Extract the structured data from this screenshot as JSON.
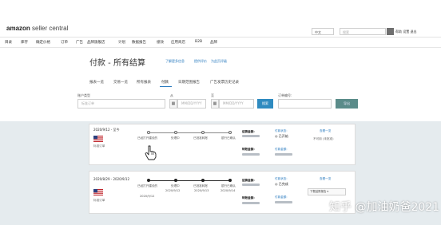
{
  "header": {
    "logo_main": "amazon",
    "logo_sub": " seller central",
    "lang": "中文",
    "search_placeholder": "搜索",
    "top_links": "帮助 设置 退出"
  },
  "nav": [
    "目录",
    "库存",
    "确定价格",
    "订单",
    "广告",
    "品牌旗舰店",
    "计划",
    "数据报告",
    "绩效",
    "应用商店",
    "B2B",
    "品牌"
  ],
  "page": {
    "title": "付款 - 所有结算",
    "title_links": [
      "了解更多信息",
      "提供评价",
      "为此页评级"
    ]
  },
  "tabs": [
    {
      "label": "报表一览",
      "active": false
    },
    {
      "label": "交易一览",
      "active": false
    },
    {
      "label": "所有报表",
      "active": false
    },
    {
      "label": "付款",
      "active": true
    },
    {
      "label": "日期范围报告",
      "active": false
    },
    {
      "label": "广告发票历史记录",
      "active": false
    }
  ],
  "filters": {
    "account_label": "账户类型",
    "account_value": "标准订单",
    "from_label": "从",
    "from_placeholder": "MM/DD/YYYY",
    "to_label": "至",
    "to_placeholder": "MM/DD/YYYY",
    "search_btn": "搜索",
    "order_label": "订单编号:",
    "export_btn": "导出"
  },
  "settlements": [
    {
      "date": "2020/9/12 - 至今",
      "type": "标准订单",
      "steps": [
        {
          "label": "已经打开建设的",
          "done": false
        },
        {
          "label": "处理中",
          "done": false
        },
        {
          "label": "已批准转账",
          "done": false
        },
        {
          "label": "银行已确认",
          "done": false
        }
      ],
      "info_labels": [
        "结算金额:",
        "转账金额:"
      ],
      "status_label": "付款状态:",
      "status_value": "已开始",
      "amount_label": "付款金额:",
      "action_link": "查看一览",
      "action_sub": "不可用 (未批准)"
    },
    {
      "date": "2020/8/29 - 2020/9/12",
      "type": "标准订单",
      "steps": [
        {
          "label": "已经打开建设的",
          "date": "2020/9/12",
          "done": true
        },
        {
          "label": "处理中",
          "date": "2020/9/12",
          "done": true
        },
        {
          "label": "已批准转账",
          "date": "2020/9/13",
          "done": true
        },
        {
          "label": "银行已确认",
          "date": "2020/9/14",
          "done": true
        }
      ],
      "info_labels": [
        "结算金额:",
        "转账金额:"
      ],
      "status_label": "付款状态:",
      "status_value": "已完成",
      "amount_label": "付款金额:",
      "action_link": "查看一览",
      "dropdown": "下载结算报告"
    }
  ],
  "watermark": "知乎 @加油奶爸2021"
}
